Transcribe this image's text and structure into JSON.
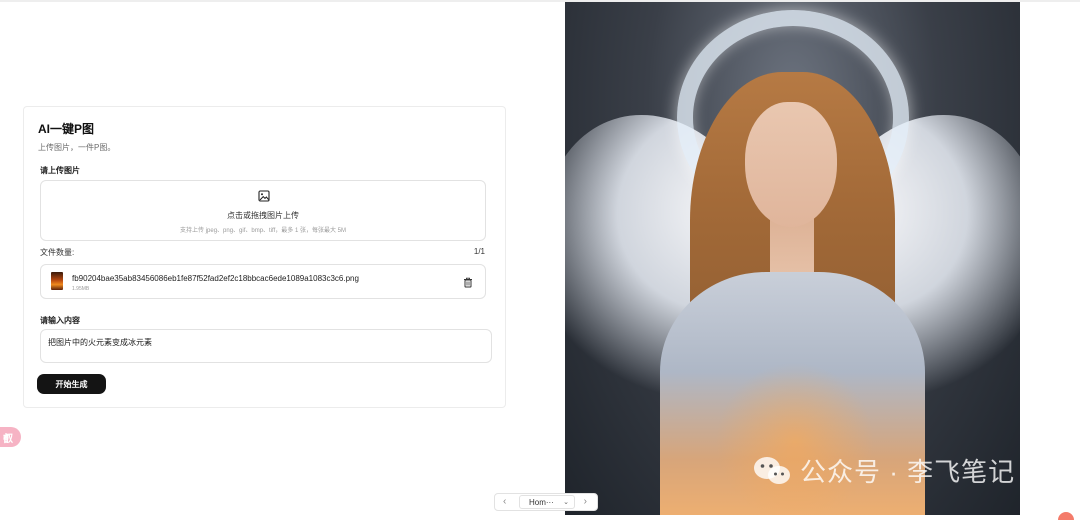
{
  "card": {
    "title": "AI一键P图",
    "subtitle": "上传图片，一件P图。",
    "upload_section_label": "请上传图片",
    "upload_text": "点击或拖拽图片上传",
    "upload_hint": "支持上传 jpeg、png、gif、bmp、tiff，最多 1 张，每张最大 5M",
    "file_count_label": "文件数量:",
    "file_count_value": "1/1",
    "file": {
      "name": "fb90204bae35ab83456086eb1fe87f52fad2ef2c18bbcac6ede1089a1083c3c6.png",
      "size": "1.95MB"
    },
    "prompt_section_label": "请输入内容",
    "prompt_value": "把图片中的火元素变成冰元素",
    "generate_button": "开始生成"
  },
  "side_widget": {
    "label": "叡"
  },
  "watermark": {
    "text": "公众号 · 李飞笔记"
  },
  "pager": {
    "selected": "Hom···"
  },
  "colors": {
    "button_bg": "#141414",
    "side_widget": "#f6b3c4",
    "border": "#e2e2e2"
  }
}
